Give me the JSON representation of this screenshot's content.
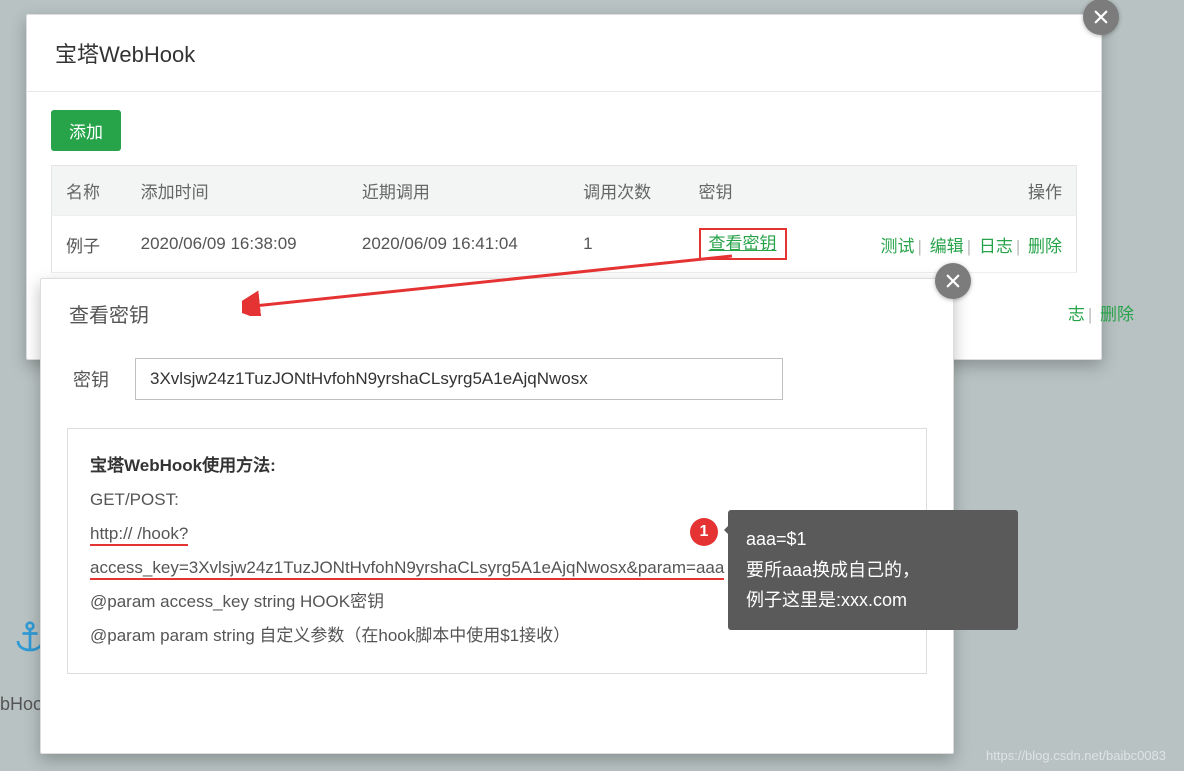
{
  "outer_modal": {
    "title": "宝塔WebHook",
    "add_button": "添加",
    "table": {
      "headers": [
        "名称",
        "添加时间",
        "近期调用",
        "调用次数",
        "密钥",
        "操作"
      ],
      "row": {
        "name": "例子",
        "add_time": "2020/06/09 16:38:09",
        "last_call": "2020/06/09 16:41:04",
        "call_count": "1",
        "key_link": "查看密钥",
        "ops": [
          "测试",
          "编辑",
          "日志",
          "删除"
        ]
      },
      "row2_ops_visible": [
        "志",
        "删除"
      ]
    }
  },
  "inner_modal": {
    "title": "查看密钥",
    "key_label": "密钥",
    "key_value": "3Xvlsjw24z1TuzJONtHvfohN9yrshaCLsyrg5A1eAjqNwosx",
    "usage": {
      "title": "宝塔WebHook使用方法:",
      "method": "GET/POST:",
      "url_line1": "http://                                   /hook?",
      "url_line2": "access_key=3Xvlsjw24z1TuzJONtHvfohN9yrshaCLsyrg5A1eAjqNwosx&param=aaa",
      "params": [
        "@param access_key string HOOK密钥",
        "@param param string 自定义参数（在hook脚本中使用$1接收）"
      ]
    }
  },
  "callout": {
    "num": "1",
    "line1": "aaa=$1",
    "line2": "要所aaa换成自己的，",
    "line3": "例子这里是:xxx.com"
  },
  "bg": {
    "hook_text": "bHook",
    "watermark": "https://blog.csdn.net/baibc0083"
  }
}
